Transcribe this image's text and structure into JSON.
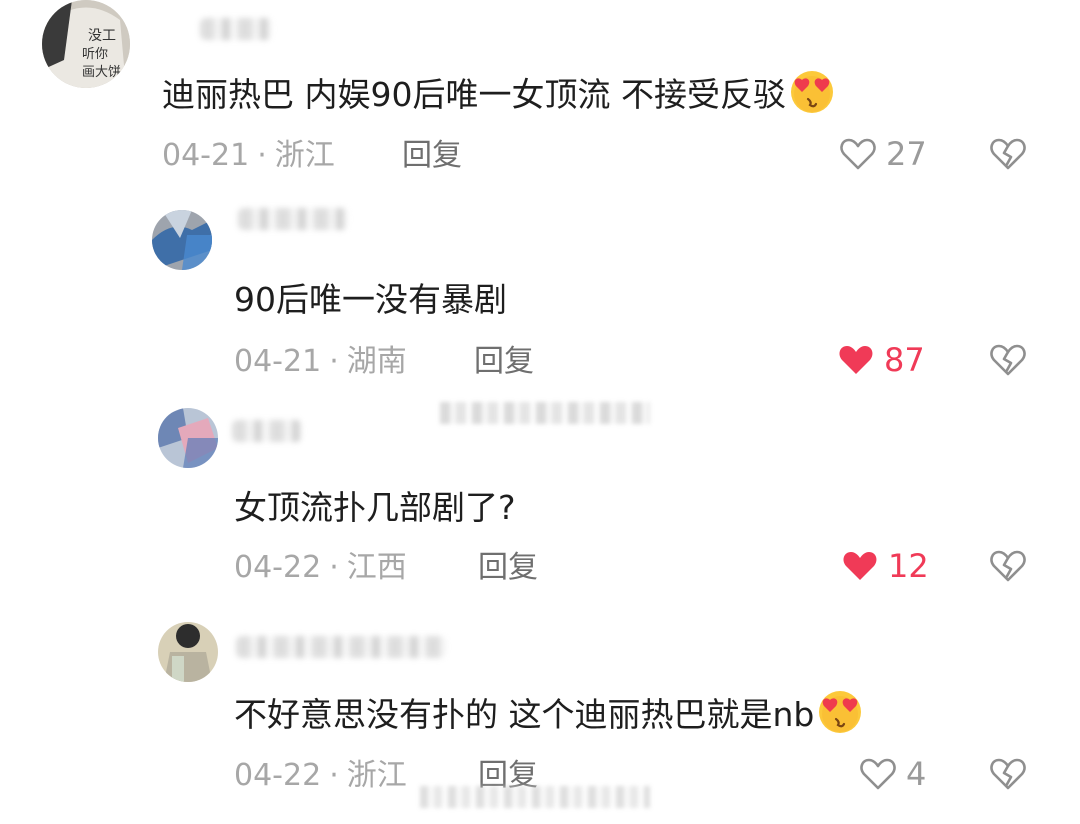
{
  "comments": [
    {
      "text": "迪丽热巴 内娱90后唯一女顶流 不接受反驳",
      "has_emoji": true,
      "date": "04-21",
      "location": "浙江",
      "reply_label": "回复",
      "like_count": "27",
      "liked": false,
      "avatar_text": "没工 听你 画大饼"
    },
    {
      "text": "90后唯一没有暴剧",
      "has_emoji": false,
      "date": "04-21",
      "location": "湖南",
      "reply_label": "回复",
      "like_count": "87",
      "liked": true
    },
    {
      "text": "女顶流扑几部剧了?",
      "has_emoji": false,
      "date": "04-22",
      "location": "江西",
      "reply_label": "回复",
      "like_count": "12",
      "liked": true
    },
    {
      "text": "不好意思没有扑的 这个迪丽热巴就是nb",
      "has_emoji": true,
      "date": "04-22",
      "location": "浙江",
      "reply_label": "回复",
      "like_count": "4",
      "liked": false
    }
  ],
  "colors": {
    "liked": "#f03a57",
    "meta": "#a7a7a7",
    "reply": "#6f6f6f",
    "text": "#1e1e1e"
  },
  "icons": {
    "like": "heart-outline-icon",
    "liked": "heart-filled-icon",
    "dislike": "broken-heart-icon",
    "emoji": "heart-eyes-emoji-icon"
  }
}
